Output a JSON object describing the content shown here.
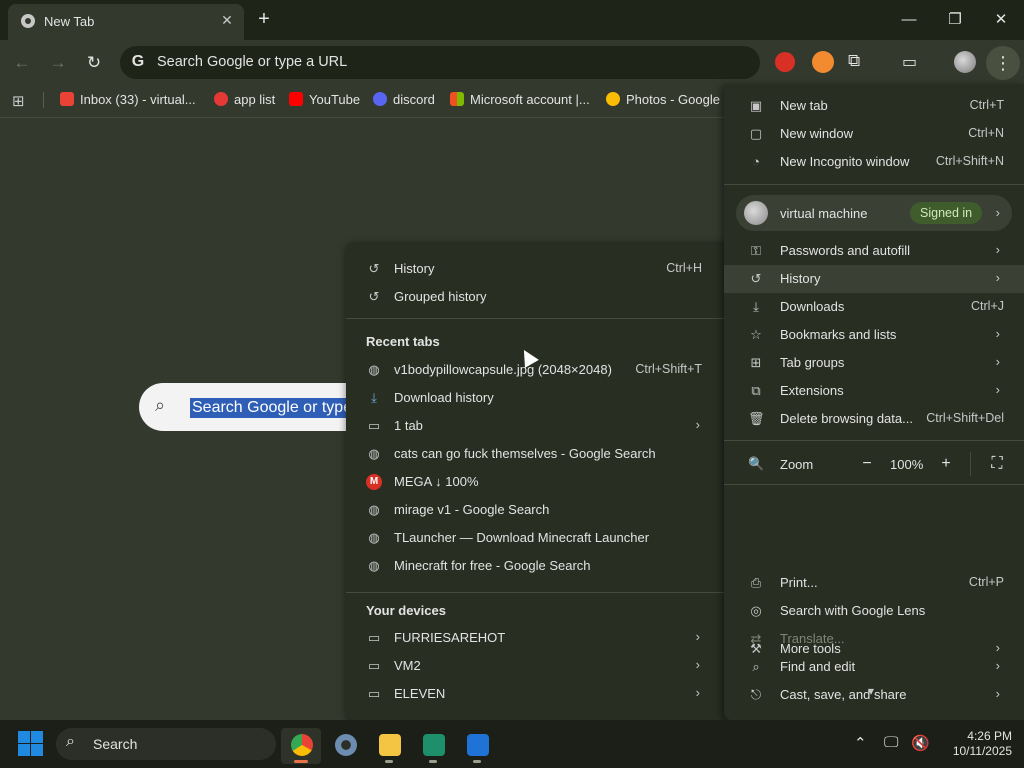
{
  "browser": {
    "tab_title": "New Tab",
    "tab_close_glyph": "✕",
    "new_tab_glyph": "+",
    "window_controls": {
      "minimize": "—",
      "maximize": "❐",
      "close": "✕"
    },
    "omnibox_text": "Search Google or type a URL",
    "omnibox_g": "G",
    "bookmarks": [
      {
        "label": "Inbox (33) - virtual...",
        "color": "#ea4335"
      },
      {
        "label": "app list",
        "color": "#e53935"
      },
      {
        "label": "YouTube",
        "color": "#ff0000"
      },
      {
        "label": "discord",
        "color": "#5865f2"
      },
      {
        "label": "Microsoft account |...",
        "color": "#f25022"
      },
      {
        "label": "Photos - Google P",
        "color": "#fbbc04"
      }
    ]
  },
  "page": {
    "search_selected_text": "Search Google or type"
  },
  "history_submenu": {
    "items": [
      {
        "icon": "history-icon",
        "glyph": "↺",
        "label": "History",
        "shortcut": "Ctrl+H"
      },
      {
        "icon": "grouped-history-icon",
        "glyph": "↺",
        "label": "Grouped history",
        "shortcut": ""
      }
    ],
    "recent_tabs_heading": "Recent tabs",
    "recent_tabs": [
      {
        "icon": "globe-icon",
        "glyph": "◍",
        "label": "v1bodypillowcapsule.jpg (2048×2048)",
        "shortcut": "Ctrl+Shift+T",
        "arrow": ""
      },
      {
        "icon": "download-icon",
        "glyph": "⤓",
        "label": "Download history",
        "shortcut": "",
        "arrow": ""
      },
      {
        "icon": "tab-window-icon",
        "glyph": "▭",
        "label": "1 tab",
        "shortcut": "",
        "arrow": "›"
      },
      {
        "icon": "globe-icon",
        "glyph": "◍",
        "label": "cats can go fuck themselves - Google Search",
        "shortcut": "",
        "arrow": ""
      },
      {
        "icon": "mega-icon",
        "glyph": "M",
        "label": "MEGA ↓ 100%",
        "shortcut": "",
        "arrow": ""
      },
      {
        "icon": "globe-icon",
        "glyph": "◍",
        "label": "mirage v1 - Google Search",
        "shortcut": "",
        "arrow": ""
      },
      {
        "icon": "globe-icon",
        "glyph": "◍",
        "label": "TLauncher — Download Minecraft Launcher",
        "shortcut": "",
        "arrow": ""
      },
      {
        "icon": "globe-icon",
        "glyph": "◍",
        "label": "Minecraft for free - Google Search",
        "shortcut": "",
        "arrow": ""
      }
    ],
    "devices_heading": "Your devices",
    "devices": [
      {
        "label": "FURRIESAREHOT",
        "arrow": "›"
      },
      {
        "label": "VM2",
        "arrow": "›"
      },
      {
        "label": "ELEVEN",
        "arrow": "›"
      }
    ]
  },
  "main_menu": {
    "top_items": [
      {
        "glyph": "▣",
        "label": "New tab",
        "shortcut": "Ctrl+T"
      },
      {
        "glyph": "▢",
        "label": "New window",
        "shortcut": "Ctrl+N"
      },
      {
        "glyph": "◔",
        "label": "New Incognito window",
        "shortcut": "Ctrl+Shift+N"
      }
    ],
    "profile": {
      "name": "virtual machine",
      "status": "Signed in",
      "arrow": "›"
    },
    "mid_items": [
      {
        "glyph": "⚿",
        "label": "Passwords and autofill",
        "shortcut": "",
        "arrow": "›"
      },
      {
        "glyph": "↺",
        "label": "History",
        "shortcut": "",
        "arrow": "›"
      },
      {
        "glyph": "⤓",
        "label": "Downloads",
        "shortcut": "Ctrl+J",
        "arrow": ""
      },
      {
        "glyph": "☆",
        "label": "Bookmarks and lists",
        "shortcut": "",
        "arrow": "›"
      },
      {
        "glyph": "⊞",
        "label": "Tab groups",
        "shortcut": "",
        "arrow": "›"
      },
      {
        "glyph": "⧉",
        "label": "Extensions",
        "shortcut": "",
        "arrow": "›"
      },
      {
        "glyph": "🗑",
        "label": "Delete browsing data...",
        "shortcut": "Ctrl+Shift+Del",
        "arrow": ""
      }
    ],
    "zoom": {
      "glyph": "🔍",
      "label": "Zoom",
      "minus": "−",
      "value": "100%",
      "plus": "+",
      "fullscreen": "⛶"
    },
    "bottom_items": [
      {
        "glyph": "⎙",
        "label": "Print...",
        "shortcut": "Ctrl+P",
        "arrow": ""
      },
      {
        "glyph": "◎",
        "label": "Search with Google Lens",
        "shortcut": "",
        "arrow": ""
      },
      {
        "glyph": "⇄",
        "label": "Translate...",
        "shortcut": "",
        "arrow": ""
      },
      {
        "glyph": "⌕",
        "label": "Find and edit",
        "shortcut": "",
        "arrow": "›"
      },
      {
        "glyph": "⎋",
        "label": "Cast, save, and share",
        "shortcut": "",
        "arrow": "›"
      },
      {
        "glyph": "⚒",
        "label": "More tools",
        "shortcut": "",
        "arrow": "›"
      }
    ],
    "scroll_more_glyph": "▾"
  },
  "taskbar": {
    "search_label": "Search",
    "time": "4:26 PM",
    "date": "10/11/2025",
    "tray_glyphs": {
      "chevron": "⌃",
      "network": "🖵",
      "volume": "🔇"
    }
  }
}
